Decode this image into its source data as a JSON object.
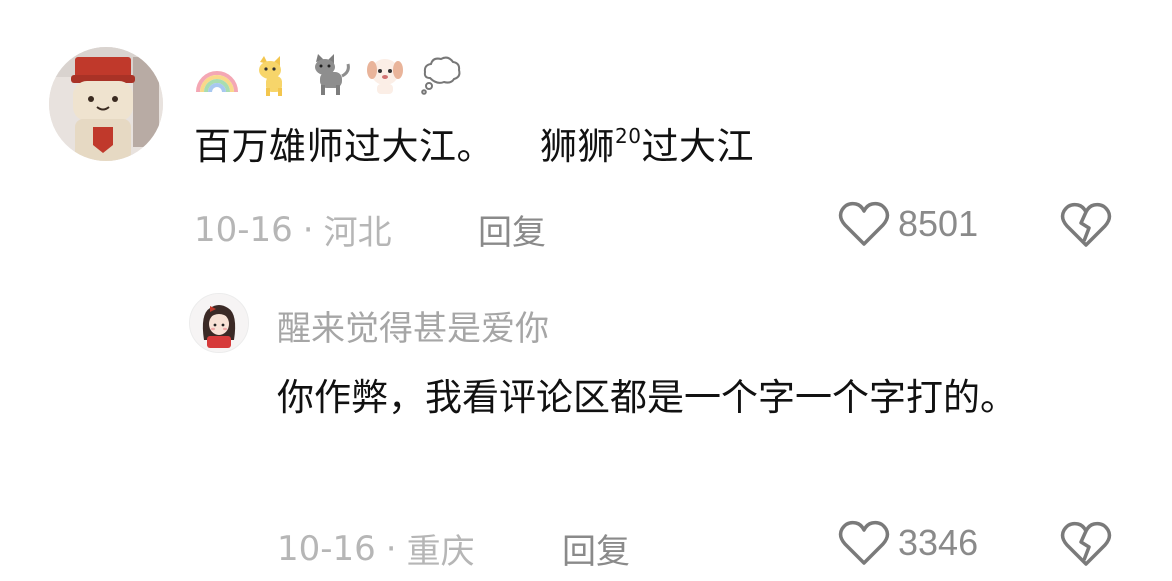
{
  "comments": [
    {
      "text_part1": "百万雄师过大江。",
      "text_part2a": "狮狮",
      "text_sup": "20",
      "text_part2b": "过大江",
      "date": "10-16",
      "separator": "·",
      "location": "河北",
      "reply_label": "回复",
      "likes": "8501",
      "badges": [
        "rainbow-icon",
        "yellow-dog-icon",
        "gray-cat-icon",
        "puppy-icon",
        "thought-bubble-icon"
      ]
    }
  ],
  "replies": [
    {
      "username": "醒来觉得甚是爱你",
      "text": "你作弊，我看评论区都是一个字一个字打的。",
      "date": "10-16",
      "separator": "·",
      "location": "重庆",
      "reply_label": "回复",
      "likes": "3346"
    }
  ],
  "colors": {
    "text_primary": "#111111",
    "text_meta": "#b6b6b6",
    "text_secondary": "#8a8a8a",
    "icon_stroke": "#7a7a7a"
  }
}
